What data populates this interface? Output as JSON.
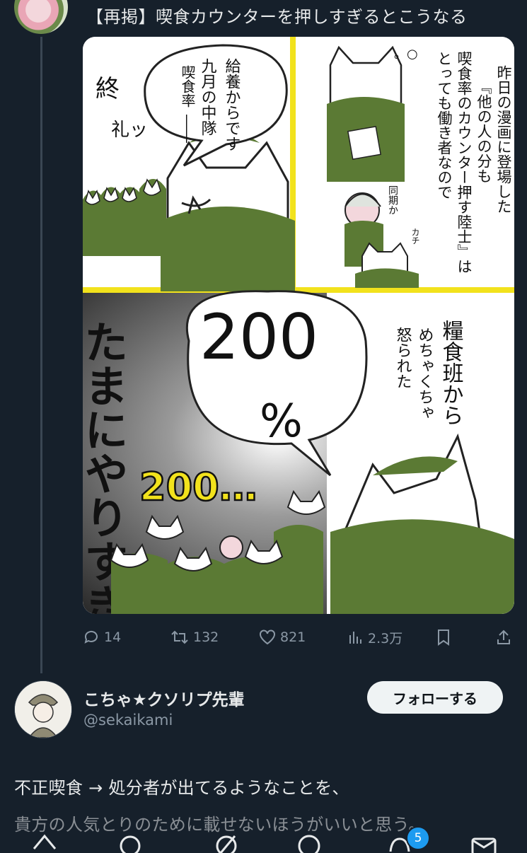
{
  "tweet": {
    "text": "【再掲】喫食カウンターを押しすぎるとこうなる",
    "manga": {
      "panel1": {
        "sfx_1": "終",
        "sfx_2": "礼ッ",
        "bubble_1": "給養からです",
        "bubble_2": "九月の中隊",
        "bubble_3": "喫食率",
        "bubble_4": "――"
      },
      "panel2": {
        "caption": [
          "昨日の漫画に登場した",
          "『他の人の分も",
          "喫食率のカウンター押す陸士』は",
          "とっても働き者なので"
        ],
        "note_1": "同期か",
        "note_2": "カチ",
        "think": "。○"
      },
      "panel3": {
        "side_text": "たまにやりすぎる",
        "bubble_number": "200",
        "bubble_unit": "%",
        "shout": "200…",
        "note_1": "糧食班から",
        "note_2": "めちゃくちゃ",
        "note_3": "怒られた"
      }
    },
    "actions": {
      "replies": "14",
      "retweets": "132",
      "likes": "821",
      "views": "2.3万"
    }
  },
  "reply": {
    "name": "こちゃ★クソリプ先輩",
    "handle": "@sekaikami",
    "follow_label": "フォローする",
    "line_1": "不正喫食 → 処分者が出てるようなことを、",
    "line_2": "貴方の人気とりのために載せないほうがいいと思う。"
  },
  "nav": {
    "notifications_badge": "5"
  },
  "colors": {
    "background": "#16202b",
    "accent": "#1d9bf0",
    "manga_green": "#5b7a34",
    "manga_yellow": "#f2e21c"
  }
}
